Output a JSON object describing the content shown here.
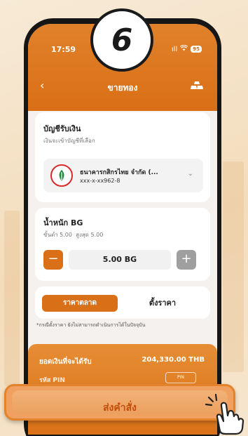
{
  "step_badge": "6",
  "status_bar": {
    "time": "17:59",
    "signal": "ıll",
    "battery": "95"
  },
  "nav": {
    "title": "ขายทอง"
  },
  "account_card": {
    "title": "บัญชีรับเงิน",
    "subtitle": "เงินจะเข้าบัญชีที่เลือก",
    "bank_name": "ธนาคารกสิกรไทย จำกัด (...",
    "account_number": "xxx-x-xx962-8"
  },
  "weight_card": {
    "title": "น้ำหนัก BG",
    "min_label": "ขั้นต่ำ 5.00",
    "max_label": "สูงสุด 5.00",
    "value": "5.00 BG",
    "minus_label": "−",
    "plus_label": "+"
  },
  "price_tabs": {
    "market_label": "ราคาตลาด",
    "set_price_label": "ตั้งราคา"
  },
  "note": "*กรณีตั้งราคา ยังไม่สามารถดำเนินการได้ในปัจจุบัน",
  "summary": {
    "total_label": "ยอดเงินที่จะได้รับ",
    "total_value": "204,330.00 THB",
    "pin_label": "รหัส PIN",
    "pin_box": "PIN"
  },
  "submit": {
    "label": "ส่งคำสั่ง"
  },
  "colors": {
    "accent": "#d96f16",
    "kbank_green": "#1a8a3a",
    "kbank_red": "#d62b2b"
  }
}
